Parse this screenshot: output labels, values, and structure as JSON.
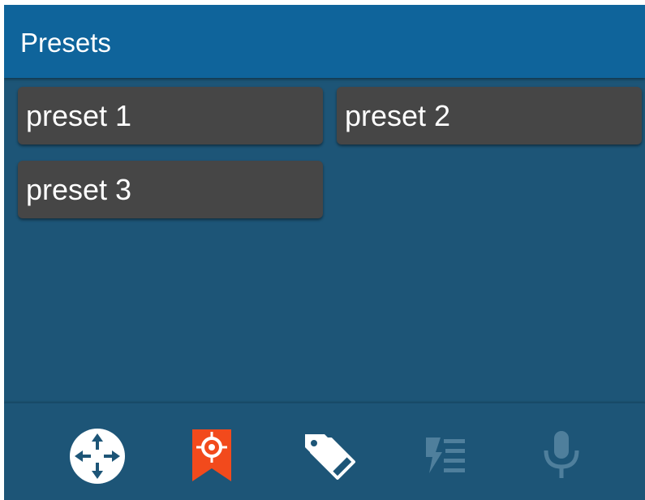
{
  "header": {
    "title": "Presets"
  },
  "presets": [
    {
      "label": "preset 1"
    },
    {
      "label": "preset 2"
    },
    {
      "label": "preset 3"
    }
  ],
  "toolbar": {
    "items": [
      {
        "icon": "move-arrows-icon",
        "active": false,
        "enabled": true
      },
      {
        "icon": "preset-target-bookmark-icon",
        "active": true,
        "enabled": true
      },
      {
        "icon": "tags-icon",
        "active": false,
        "enabled": true
      },
      {
        "icon": "flash-list-icon",
        "active": false,
        "enabled": false
      },
      {
        "icon": "microphone-icon",
        "active": false,
        "enabled": false
      }
    ]
  },
  "colors": {
    "header_bg": "#0f649b",
    "body_bg": "#1d5577",
    "button_bg": "#464646",
    "active_accent": "#f24a1c",
    "icon_white": "#ffffff",
    "icon_disabled": "#4f7f9c"
  }
}
